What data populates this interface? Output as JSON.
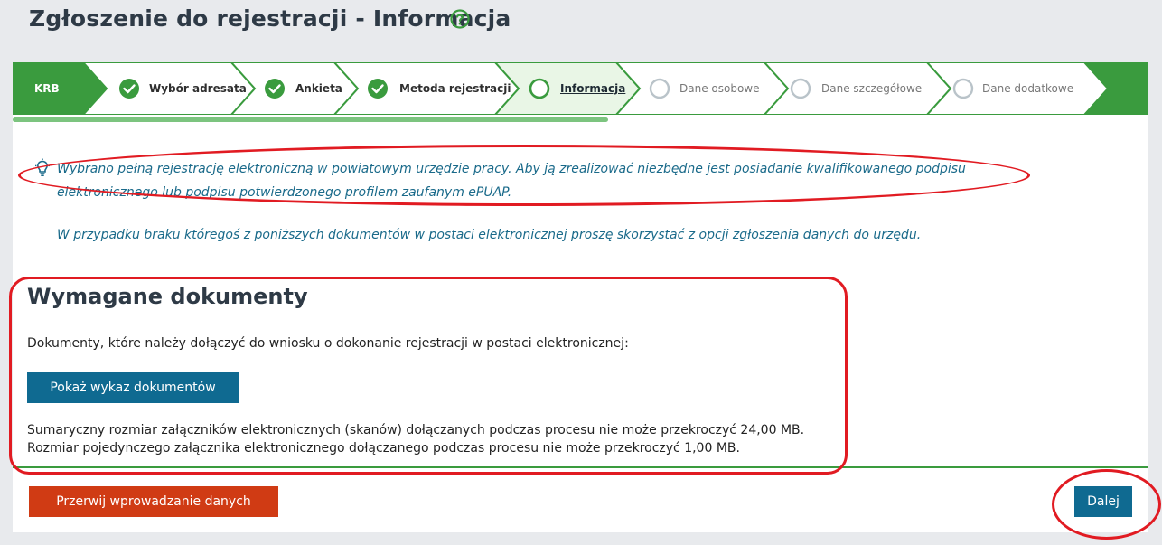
{
  "page": {
    "title": "Zgłoszenie do rejestracji - Informacja",
    "help_icon": "question-circle-icon"
  },
  "steps": [
    {
      "label": "KRB",
      "state": "start"
    },
    {
      "label": "Wybór adresata",
      "state": "done"
    },
    {
      "label": "Ankieta",
      "state": "done"
    },
    {
      "label": "Metoda rejestracji",
      "state": "done"
    },
    {
      "label": "Informacja",
      "state": "current"
    },
    {
      "label": "Dane osobowe",
      "state": "todo"
    },
    {
      "label": "Dane szczegółowe",
      "state": "todo"
    },
    {
      "label": "Dane dodatkowe",
      "state": "todo"
    }
  ],
  "progress": {
    "fraction": 0.525
  },
  "info": {
    "icon": "lightbulb-icon",
    "text": "Wybrano pełną rejestrację elektroniczną w powiatowym urzędzie pracy. Aby ją zrealizować niezbędne jest posiadanie kwalifikowanego podpisu elektronicznego lub podpisu potwierdzonego profilem zaufanym ePUAP.",
    "text2": "W przypadku braku któregoś z poniższych dokumentów w postaci elektronicznej proszę skorzystać z opcji zgłoszenia danych do urzędu."
  },
  "documents": {
    "title": "Wymagane dokumenty",
    "description": "Dokumenty, które należy dołączyć do wniosku o dokonanie rejestracji w postaci elektronicznej:",
    "show_button": "Pokaż wykaz dokumentów",
    "limit_total": "Sumaryczny rozmiar załączników elektronicznych (skanów) dołączanych podczas procesu nie może przekroczyć 24,00 MB.",
    "limit_single": "Rozmiar pojedynczego załącznika elektronicznego dołączanego podczas procesu nie może przekroczyć 1,00 MB."
  },
  "footer": {
    "cancel_button": "Przerwij wprowadzanie danych",
    "next_button": "Dalej"
  },
  "colors": {
    "accent_green": "#3a9b3e",
    "primary_blue": "#0f6a91",
    "danger_red": "#d03b14",
    "annotation_red": "#e11b22"
  }
}
